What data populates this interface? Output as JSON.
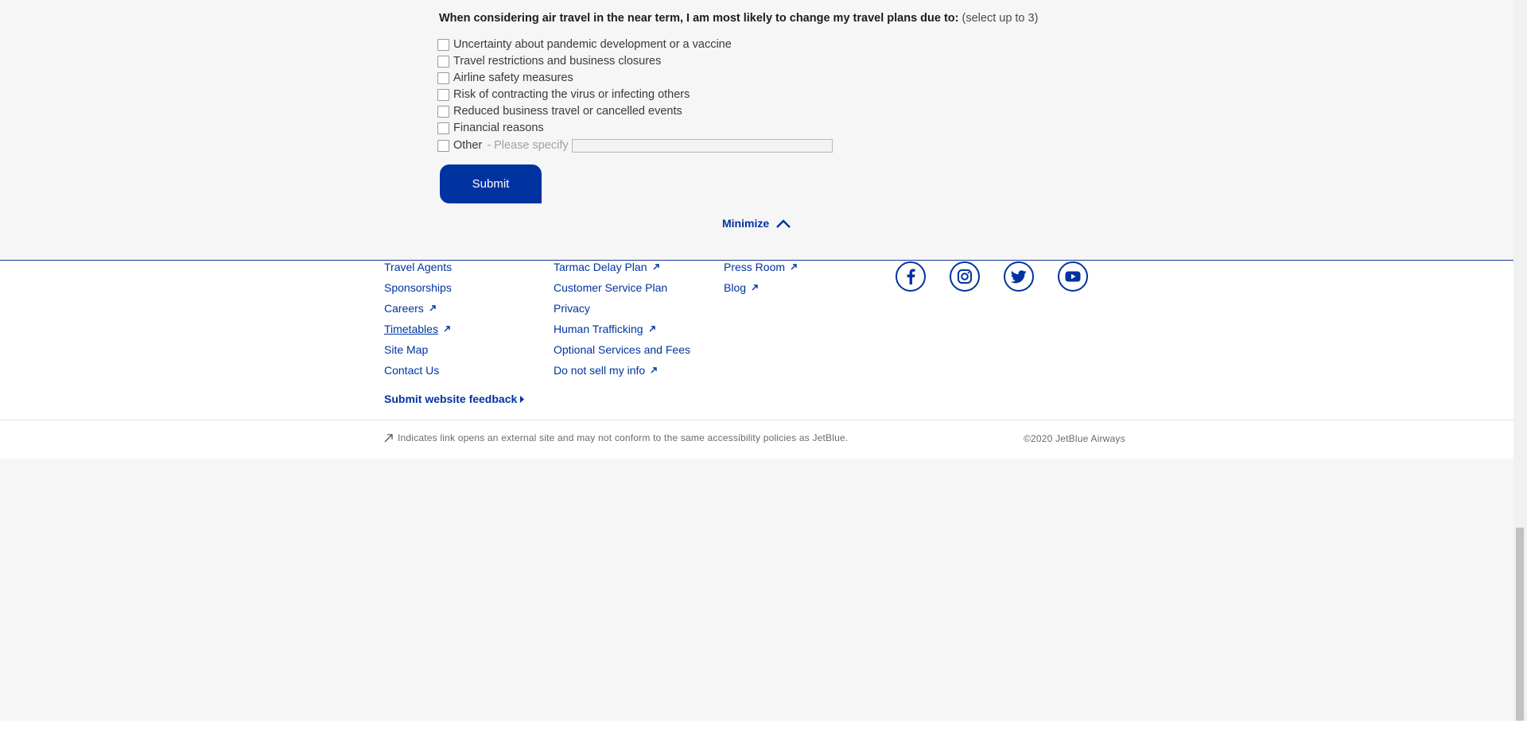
{
  "survey": {
    "question_bold": "When considering air travel in the near term, I am most likely to change my travel plans due to:",
    "question_hint": "(select up to 3)",
    "options": [
      "Uncertainty about pandemic development or a vaccine",
      "Travel restrictions and business closures",
      "Airline safety measures",
      "Risk of contracting the virus or infecting others",
      "Reduced business travel or cancelled events",
      "Financial reasons"
    ],
    "other_label": "Other",
    "other_specify": "- Please specify",
    "other_value": "",
    "submit_label": "Submit",
    "minimize_label": "Minimize"
  },
  "footer": {
    "col1": [
      "Travel Agents",
      "Sponsorships",
      "Careers",
      "Timetables",
      "Site Map",
      "Contact Us"
    ],
    "col2": [
      "Tarmac Delay Plan",
      "Customer Service Plan",
      "Privacy",
      "Human Trafficking",
      "Optional Services and Fees",
      "Do not sell my info"
    ],
    "col3": [
      "Press Room",
      "Blog"
    ],
    "social_icons": [
      "facebook-icon",
      "instagram-icon",
      "twitter-icon",
      "youtube-icon"
    ],
    "feedback_label": "Submit website feedback",
    "external_note": "Indicates link opens an external site and may not conform to the same accessibility policies as JetBlue.",
    "copyright": "©2020 JetBlue Airways"
  },
  "colors": {
    "brand_blue": "#0033a0",
    "background": "#f6f6f6"
  }
}
